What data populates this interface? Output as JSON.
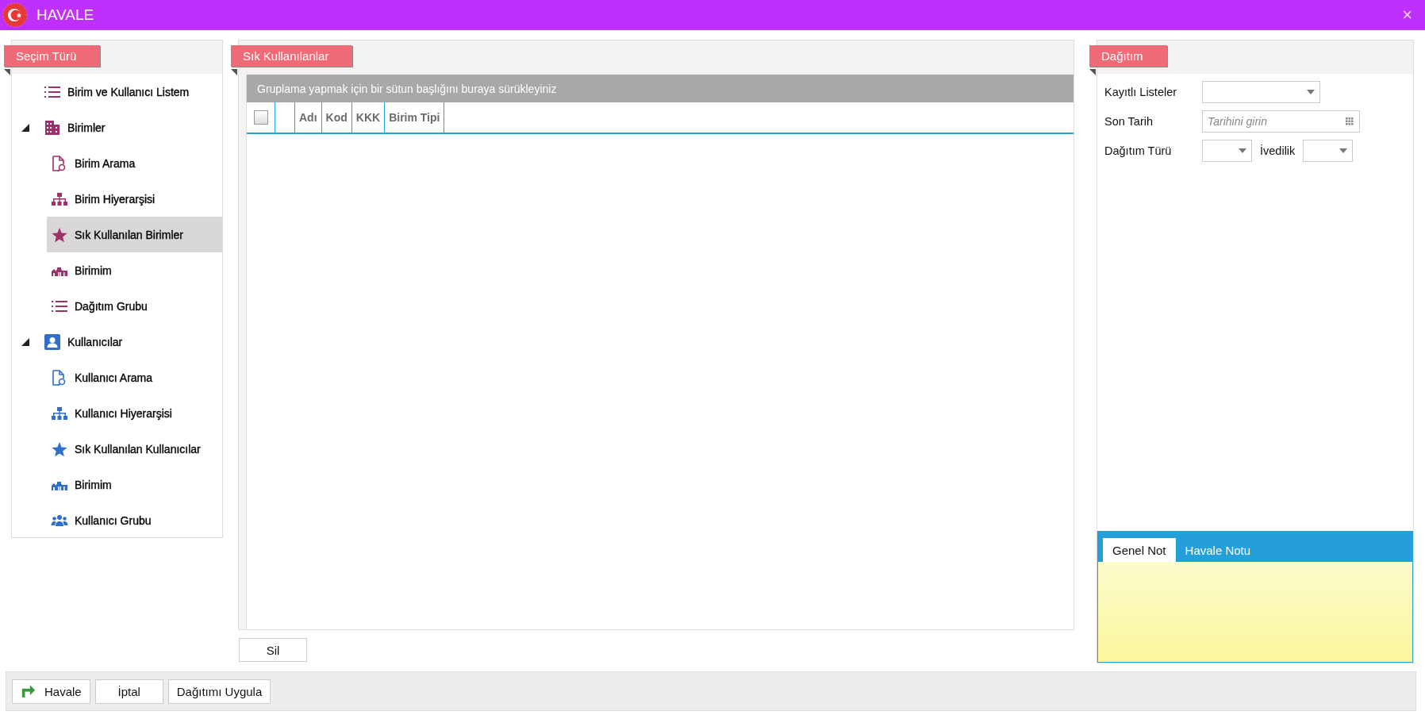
{
  "window": {
    "title": "HAVALE",
    "close": "×"
  },
  "sidebar": {
    "title": "Seçim Türü",
    "items": [
      {
        "label": "Birim ve Kullanıcı Listem",
        "kind": "list",
        "color": "#a0306a",
        "selected": false
      },
      {
        "label": "Birimler",
        "kind": "building",
        "color": "#a0306a",
        "selected": false,
        "expanded": true,
        "children": [
          {
            "label": "Birim Arama",
            "kind": "search",
            "color": "#a0306a",
            "selected": false
          },
          {
            "label": "Birim Hiyerarşisi",
            "kind": "hierarchy",
            "color": "#a0306a",
            "selected": false
          },
          {
            "label": "Sık Kullanılan Birimler",
            "kind": "star",
            "color": "#a0306a",
            "selected": true
          },
          {
            "label": "Birimim",
            "kind": "unit",
            "color": "#a0306a",
            "selected": false
          },
          {
            "label": "Dağıtım Grubu",
            "kind": "list",
            "color": "#a0306a",
            "selected": false
          }
        ]
      },
      {
        "label": "Kullanıcılar",
        "kind": "user",
        "color": "#2f6fc9",
        "selected": false,
        "expanded": true,
        "children": [
          {
            "label": "Kullanıcı Arama",
            "kind": "search",
            "color": "#2f6fc9",
            "selected": false
          },
          {
            "label": "Kullanıcı Hiyerarşisi",
            "kind": "hierarchy",
            "color": "#2f6fc9",
            "selected": false
          },
          {
            "label": "Sık Kullanılan Kullanıcılar",
            "kind": "star",
            "color": "#2f6fc9",
            "selected": false
          },
          {
            "label": "Birimim",
            "kind": "unit",
            "color": "#2f6fc9",
            "selected": false
          },
          {
            "label": "Kullanıcı Grubu",
            "kind": "group",
            "color": "#2f6fc9",
            "selected": false
          }
        ]
      }
    ]
  },
  "favorites": {
    "title": "Sık Kullanılanlar",
    "group_hint": "Gruplama yapmak için bir sütun başlığını buraya sürükleyiniz",
    "select_all": {
      "checked": false
    },
    "columns": [
      {
        "label": "Adı"
      },
      {
        "label": "Kod"
      },
      {
        "label": "KKK"
      },
      {
        "label": "Birim Tipi"
      }
    ],
    "delete_button": "Sil"
  },
  "distribution": {
    "title": "Dağıtım",
    "rows": [
      {
        "fields": [
          {
            "label": "Kayıtlı Listeler",
            "kind": "wide_dropdown"
          }
        ]
      },
      {
        "fields": [
          {
            "label": "Son Tarih",
            "kind": "date",
            "placeholder": "Tarihini girin"
          }
        ]
      },
      {
        "fields": [
          {
            "label": "Dağıtım Türü",
            "kind": "small_dropdown"
          },
          {
            "label": "İvedilik",
            "kind": "small_dropdown"
          }
        ]
      }
    ],
    "note_tabs": [
      {
        "label": "Genel Not",
        "selected": true
      },
      {
        "label": "Havale Notu",
        "selected": false
      }
    ]
  },
  "buttons": [
    {
      "label": "Havale",
      "kind": "icon"
    },
    {
      "label": "İptal",
      "kind": "text"
    },
    {
      "label": "Dağıtımı Uygula",
      "kind": "text"
    }
  ]
}
